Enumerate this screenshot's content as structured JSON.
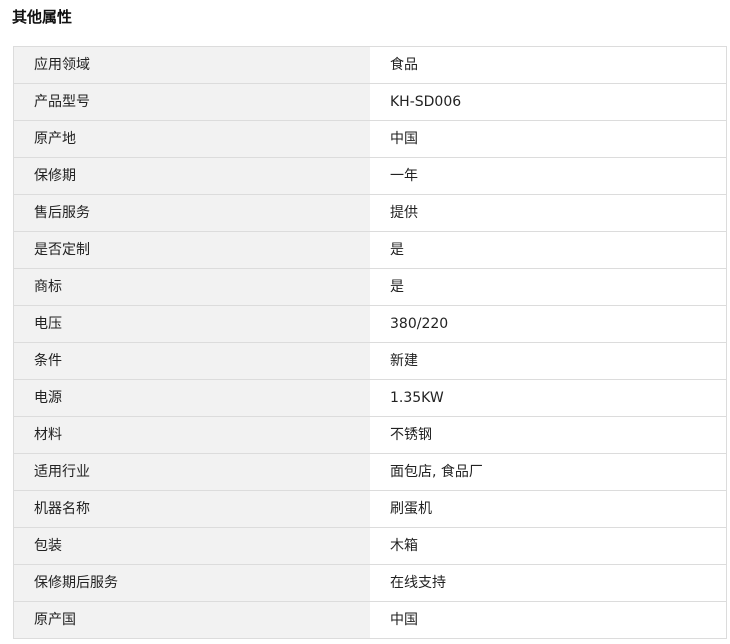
{
  "section": {
    "title": "其他属性"
  },
  "attributes": [
    {
      "key": "应用领域",
      "value": "食品"
    },
    {
      "key": "产品型号",
      "value": "KH-SD006"
    },
    {
      "key": "原产地",
      "value": "中国"
    },
    {
      "key": "保修期",
      "value": "一年"
    },
    {
      "key": "售后服务",
      "value": "提供"
    },
    {
      "key": "是否定制",
      "value": "是"
    },
    {
      "key": "商标",
      "value": "是"
    },
    {
      "key": "电压",
      "value": "380/220"
    },
    {
      "key": "条件",
      "value": "新建"
    },
    {
      "key": "电源",
      "value": "1.35KW"
    },
    {
      "key": "材料",
      "value": "不锈钢"
    },
    {
      "key": "适用行业",
      "value": "面包店, 食品厂"
    },
    {
      "key": "机器名称",
      "value": "刷蛋机"
    },
    {
      "key": "包装",
      "value": "木箱"
    },
    {
      "key": "保修期后服务",
      "value": "在线支持"
    },
    {
      "key": "原产国",
      "value": "中国"
    }
  ],
  "colors": {
    "key_background": "#f2f2f2",
    "border": "#dcdcdc",
    "text": "#222222"
  }
}
